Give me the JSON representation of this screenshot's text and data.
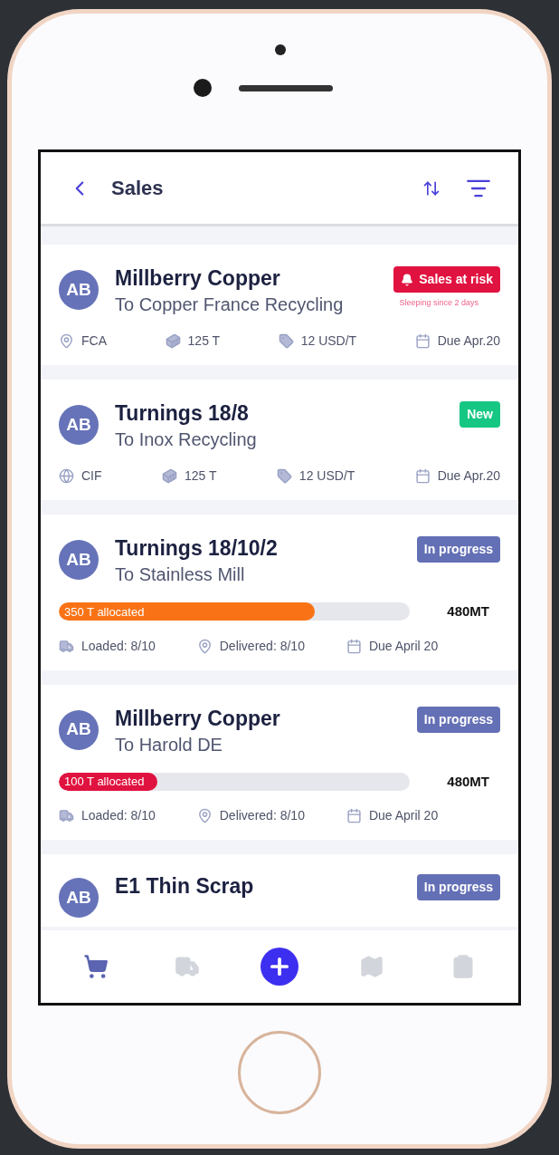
{
  "header": {
    "title": "Sales"
  },
  "cards": [
    {
      "kind": "info",
      "avatar": "AB",
      "title": "Millberry Copper",
      "subtitle": "To Copper France Recycling",
      "status": {
        "label": "Sales at risk",
        "color": "#e0123f",
        "alert": true,
        "note": "Sleeping since 2 days"
      },
      "meta": [
        {
          "kind": "location",
          "text": "FCA"
        },
        {
          "kind": "quantity",
          "text": "125 T"
        },
        {
          "kind": "price",
          "text": "12 USD/T"
        },
        {
          "kind": "date",
          "text": "Due Apr.20"
        }
      ]
    },
    {
      "kind": "info",
      "avatar": "AB",
      "title": "Turnings 18/8",
      "subtitle": "To Inox Recycling",
      "status": {
        "label": "New",
        "color": "#16c784",
        "alert": false
      },
      "meta": [
        {
          "kind": "international",
          "text": "CIF"
        },
        {
          "kind": "quantity",
          "text": "125 T"
        },
        {
          "kind": "price",
          "text": "12 USD/T"
        },
        {
          "kind": "date",
          "text": "Due Apr.20"
        }
      ]
    },
    {
      "kind": "progress",
      "avatar": "AB",
      "title": "Turnings 18/10/2",
      "subtitle": "To Stainless Mill",
      "status": {
        "label": "In progress",
        "color": "#6470b5",
        "alert": false
      },
      "bar": {
        "label": "350 T allocated",
        "level": 0.73,
        "color": "#f97316",
        "total": "480MT"
      },
      "meta": [
        {
          "kind": "loaded",
          "text": "Loaded: 8/10"
        },
        {
          "kind": "delivered",
          "text": "Delivered: 8/10"
        },
        {
          "kind": "date",
          "text": "Due April 20"
        }
      ]
    },
    {
      "kind": "progress",
      "avatar": "AB",
      "title": "Millberry Copper",
      "subtitle": "To Harold DE",
      "status": {
        "label": "In progress",
        "color": "#6470b5",
        "alert": false
      },
      "bar": {
        "label": "100 T allocated",
        "level": 0.28,
        "color": "#e0123f",
        "total": "480MT"
      },
      "meta": [
        {
          "kind": "loaded",
          "text": "Loaded: 8/10"
        },
        {
          "kind": "delivered",
          "text": "Delivered: 8/10"
        },
        {
          "kind": "date",
          "text": "Due April 20"
        }
      ]
    },
    {
      "kind": "partial",
      "avatar": "AB",
      "title": "E1 Thin Scrap",
      "status": {
        "label": "In progress",
        "color": "#6470b5",
        "alert": false
      }
    }
  ],
  "nav": [
    {
      "kind": "cart",
      "selected": true
    },
    {
      "kind": "truck",
      "selected": false
    },
    {
      "kind": "add",
      "selected": false
    },
    {
      "kind": "map",
      "selected": false
    },
    {
      "kind": "tasks",
      "selected": false
    }
  ]
}
